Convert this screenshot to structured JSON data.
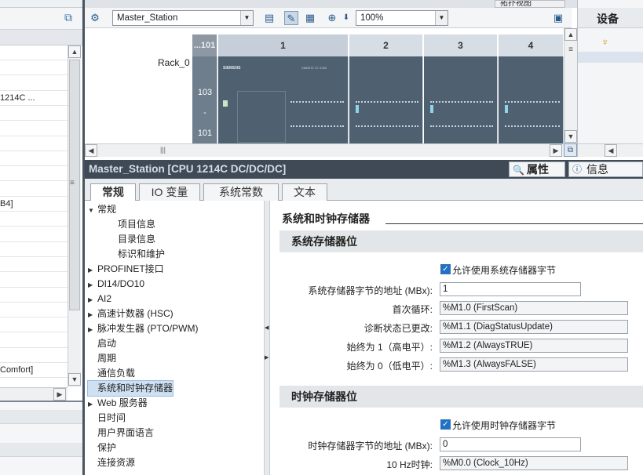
{
  "left_pane": {
    "rows": [
      "",
      "",
      "",
      "1214C ...",
      "",
      "",
      "",
      "",
      "",
      "",
      "B4]",
      "",
      "",
      "",
      "",
      "",
      "",
      "",
      "",
      "",
      "",
      "Comfort]"
    ]
  },
  "device_view": {
    "station_select": "Master_Station",
    "zoom_select": "100%",
    "rack_label": "Rack_0",
    "slot_headers": [
      "...101",
      "1",
      "2",
      "3",
      "4"
    ],
    "row_numbers": [
      "103",
      "-",
      "101"
    ],
    "cpu_brand": "SIEMENS",
    "cpu_model": "SIMATIC S7-1200"
  },
  "right_pane": {
    "tab_label": "设备"
  },
  "top_tab": {
    "label": "拓扑视图"
  },
  "inspector": {
    "title": "Master_Station [CPU 1214C DC/DC/DC]",
    "properties_tab": "属性",
    "info_tab": "信息",
    "tabs": [
      "常规",
      "IO 变量",
      "系统常数",
      "文本"
    ]
  },
  "nav": {
    "items": [
      {
        "label": "常规",
        "expandable": true,
        "expanded": true,
        "indent": 0
      },
      {
        "label": "项目信息",
        "indent": 1
      },
      {
        "label": "目录信息",
        "indent": 1
      },
      {
        "label": "标识和维护",
        "indent": 1
      },
      {
        "label": "PROFINET接口",
        "expandable": true,
        "indent": 0
      },
      {
        "label": "DI14/DO10",
        "expandable": true,
        "indent": 0
      },
      {
        "label": "AI2",
        "expandable": true,
        "indent": 0
      },
      {
        "label": "高速计数器 (HSC)",
        "expandable": true,
        "indent": 0
      },
      {
        "label": "脉冲发生器 (PTO/PWM)",
        "expandable": true,
        "indent": 0
      },
      {
        "label": "启动",
        "indent": 0
      },
      {
        "label": "周期",
        "indent": 0
      },
      {
        "label": "通信负载",
        "indent": 0
      },
      {
        "label": "系统和时钟存储器",
        "indent": 0,
        "selected": true
      },
      {
        "label": "Web 服务器",
        "expandable": true,
        "indent": 0
      },
      {
        "label": "日时间",
        "indent": 0
      },
      {
        "label": "用户界面语言",
        "indent": 0
      },
      {
        "label": "保护",
        "indent": 0
      },
      {
        "label": "连接资源",
        "indent": 0
      }
    ]
  },
  "props": {
    "heading": "系统和时钟存储器",
    "system_section": {
      "title": "系统存储器位",
      "enable_label": "允许使用系统存储器字节",
      "enabled": true,
      "address_label": "系统存储器字节的地址 (MBx):",
      "address_value": "1",
      "bits": [
        {
          "label": "首次循环:",
          "value": "%M1.0 (FirstScan)"
        },
        {
          "label": "诊断状态已更改:",
          "value": "%M1.1 (DiagStatusUpdate)"
        },
        {
          "label": "始终为 1（高电平）:",
          "value": "%M1.2 (AlwaysTRUE)"
        },
        {
          "label": "始终为 0（低电平）:",
          "value": "%M1.3 (AlwaysFALSE)"
        }
      ]
    },
    "clock_section": {
      "title": "时钟存储器位",
      "enable_label": "允许使用时钟存储器字节",
      "enabled": true,
      "address_label": "时钟存储器字节的地址 (MBx):",
      "address_value": "0",
      "bits": [
        {
          "label": "10 Hz时钟:",
          "value": "%M0.0 (Clock_10Hz)"
        }
      ]
    }
  }
}
